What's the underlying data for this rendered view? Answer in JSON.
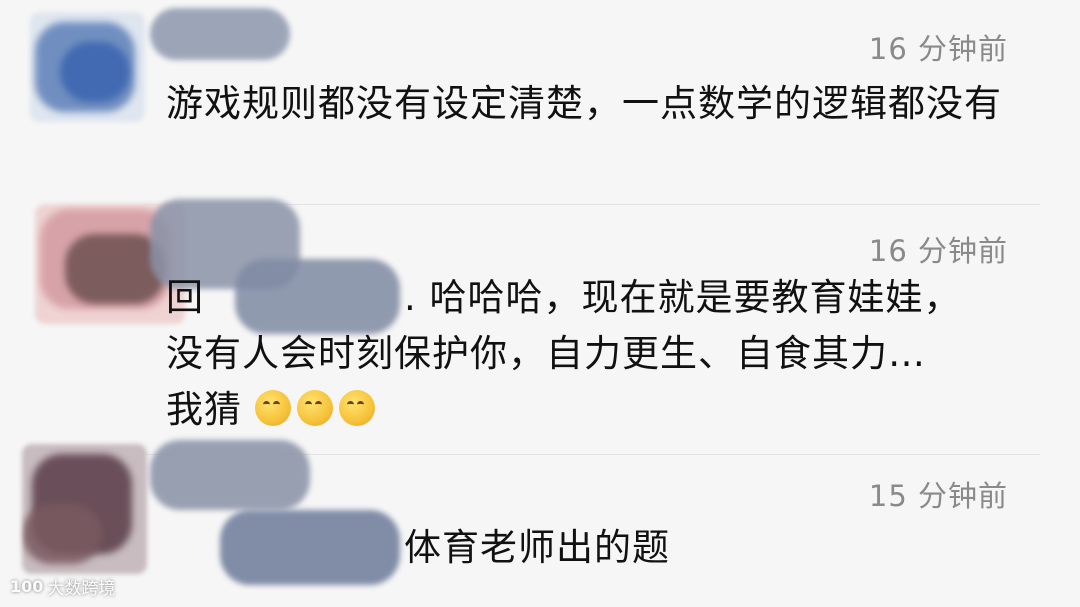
{
  "comments": [
    {
      "time": "16 分钟前",
      "text": "游戏规则都没有设定清楚，一点数学的逻辑都没有"
    },
    {
      "time": "16 分钟前",
      "reply_prefix": "回",
      "text_line1": ". 哈哈哈，现在就是要教育娃娃，",
      "text_line2": "没有人会时刻保护你，自力更生、自食其力…",
      "text_line3": "我猜",
      "emojis": [
        "thinking-face-icon",
        "thinking-face-icon",
        "thinking-face-icon"
      ]
    },
    {
      "time": "15 分钟前",
      "text": "体育老师出的题"
    }
  ],
  "watermark": {
    "logo": "100",
    "text": "大数跨境"
  },
  "colors": {
    "background": "#f6f6f6",
    "time_text": "#8a8a8a",
    "body_text": "#111111"
  }
}
